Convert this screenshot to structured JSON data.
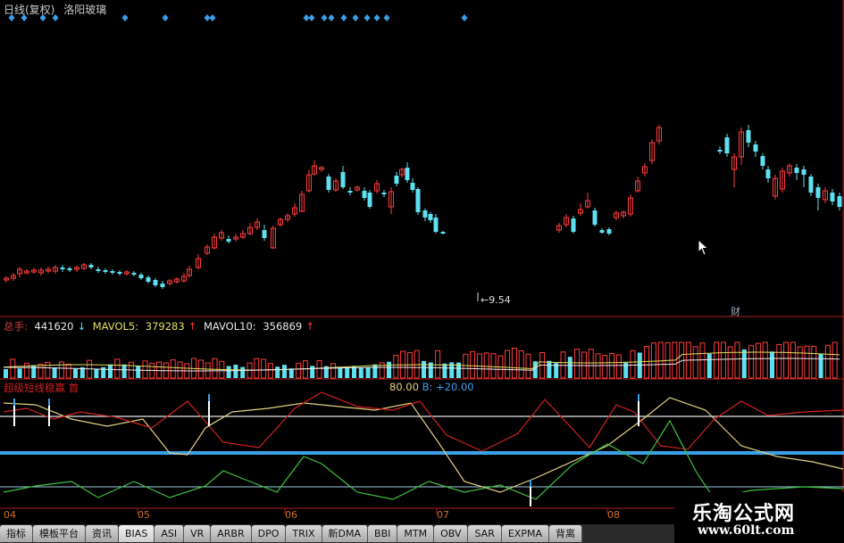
{
  "header": {
    "period": "日线(复权)",
    "stock_name": "洛阳玻璃"
  },
  "colors": {
    "up": "#ff3b3b",
    "down": "#5fe0f0",
    "accent_blue": "#3aa0e8",
    "white_line": "#e8e8e8",
    "yellow_line": "#e0d080",
    "green_line": "#40c040",
    "red_line": "#d02020",
    "axis": "#b02020"
  },
  "price_panel": {
    "low_label": "←9.54",
    "fin_marker": "财"
  },
  "volume_panel": {
    "total_label": "总手: ",
    "total_value": "441620",
    "total_arrow": "↓",
    "mavol5_label": "MAVOL5: ",
    "mavol5_value": "379283",
    "mavol5_arrow": "↑",
    "mavol10_label": "MAVOL10: ",
    "mavol10_value": "356869",
    "mavol10_arrow": "↑"
  },
  "indicator_panel": {
    "name": "超级短线稳赢",
    "flag": "首",
    "line_a": "80.00",
    "line_b": "B: +20.00"
  },
  "x_axis": [
    "04",
    "05",
    "06",
    "07",
    "08"
  ],
  "tabs": [
    "指标",
    "模板平台",
    "资讯",
    "BIAS",
    "ASI",
    "VR",
    "ARBR",
    "DPO",
    "TRIX",
    "新DMA",
    "BBI",
    "MTM",
    "OBV",
    "SAR",
    "EXPMA",
    "背离"
  ],
  "active_tab": "BIAS",
  "watermark": {
    "name": "乐淘公式网",
    "url": "www.60lt.com"
  }
}
